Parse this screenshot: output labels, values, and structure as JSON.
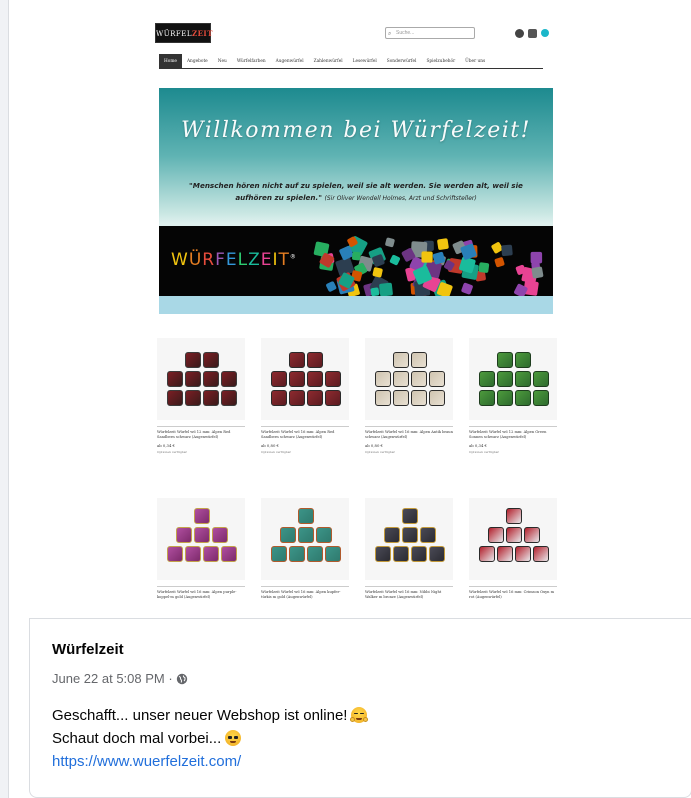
{
  "site": {
    "logo_text": "WÜRFELZEIT",
    "search_placeholder": "Suche...",
    "nav": [
      "Home",
      "Angebote",
      "Neu",
      "Würfelfarben",
      "Augenwürfel",
      "Zahlenwürfel",
      "Lesewürfel",
      "Sonderwürfel",
      "Spielzubehör",
      "Über uns"
    ],
    "hero_title": "Willkommen  bei Würfelzeit!",
    "hero_quote": "\"Menschen hören nicht auf zu spielen, weil sie alt werden. Sie werden alt, weil sie aufhören zu spielen.\"",
    "hero_quote_attr": "(Sir Oliver Wendell Holmes, Arzt und Schriftsteller)",
    "band_logo": [
      "W",
      "Ü",
      "R",
      "F",
      "E",
      "L",
      "Z",
      "E",
      "I",
      "T"
    ],
    "band_logo_mark": "®",
    "products": [
      {
        "caption": "Würfelzeit Würfel w6 12 mm: Alpen Red Sandbern schwarz (Augenwürfel)",
        "price": "ab 0,34 €",
        "avail": "Optionen verfügbar",
        "colors": [
          "#3a1a1a",
          "#7b1e24",
          "#3b3b3b"
        ]
      },
      {
        "caption": "Würfelzeit Würfel w6 16 mm: Alpen Red Sandbern schwarz (Augenwürfel)",
        "price": "ab 0,80 €",
        "avail": "Optionen verfügbar",
        "colors": [
          "#5b1b20",
          "#8e2a2f",
          "#2a2a2a"
        ]
      },
      {
        "caption": "Würfelzeit Würfel w6 16 mm: Alpen Antik braun schwarz (Augenwürfel)",
        "price": "ab 0,80 €",
        "avail": "Optionen verfügbar",
        "colors": [
          "#e8e0d2",
          "#cfc4b0",
          "#2b2b2b"
        ]
      },
      {
        "caption": "Würfelzeit Würfel w6 12 mm: Alpen Green Sonnen schwarz (Augenwürfel)",
        "price": "ab 0,34 €",
        "avail": "Optionen verfügbar",
        "colors": [
          "#2e6b2e",
          "#4c9a3c",
          "#1e3d1e"
        ]
      },
      {
        "caption": "Würfelzeit Würfel w6 16 mm: Alpen purple-koppel-m gold (Augenwürfel)",
        "price": "",
        "avail": "",
        "colors": [
          "#7d2a6b",
          "#b04fa0",
          "#c3a24a"
        ]
      },
      {
        "caption": "Würfelzeit Würfel w6 16 mm: Alpen kupfer-türkis m gold (Augenwürfel)",
        "price": "",
        "avail": "",
        "colors": [
          "#2f7a6e",
          "#3c9488",
          "#b05a2c"
        ]
      },
      {
        "caption": "Würfelzeit Würfel w6 16 mm: Nibbi Night Walker m bronze (Augenwürfel)",
        "price": "",
        "avail": "",
        "colors": [
          "#2b2b32",
          "#4a4a56",
          "#c39a3a"
        ]
      },
      {
        "caption": "Würfelzeit Würfel w6 16 mm: Crimson Oxyn m rot (Augenwürfel)",
        "price": "",
        "avail": "",
        "colors": [
          "#e9e9ec",
          "#b21e2a",
          "#2a2a2a"
        ]
      }
    ]
  },
  "post": {
    "page_name": "Würfelzeit",
    "timestamp": "June 22 at 5:08 PM · ",
    "line1": "Geschafft... unser neuer Webshop ist online!",
    "line2": "Schaut doch mal vorbei...",
    "link": "https://www.wuerfelzeit.com/"
  },
  "icons": {
    "audience": "globe-icon",
    "emoji1": "hugging-face-emoji",
    "emoji2": "sunglasses-face-emoji"
  },
  "colors": {
    "link": "#216fdb",
    "meta": "#65676b"
  }
}
